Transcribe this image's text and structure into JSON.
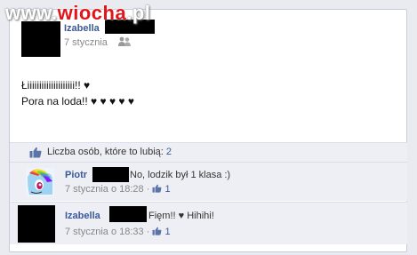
{
  "watermark": {
    "prefix": "www.",
    "brand": "wiocha",
    "suffix": ".pl"
  },
  "post": {
    "author": "Izabella",
    "date": "7 stycznia",
    "audience_icon": "people-icon",
    "lines": [
      "Łiiiiiiiiiiiiiiiiiiii!! ♥",
      "Pora na loda!! ♥ ♥ ♥ ♥ ♥"
    ]
  },
  "likes": {
    "icon": "thumbs-up-icon",
    "label": "Liczba osób, które to lubią: ",
    "count": "2"
  },
  "comments": [
    {
      "author": "Piotr",
      "text": "No, lodzik był 1 klasa :)",
      "time": "7 stycznia o 18:28",
      "likes": "1"
    },
    {
      "author": "Izabella",
      "text": "Fięm!! ♥ Hihihi!",
      "time": "7 stycznia o 18:33",
      "likes": "1"
    }
  ],
  "colors": {
    "link": "#3b5998",
    "comment_bg": "#edeff4",
    "border": "#c4cde0"
  }
}
